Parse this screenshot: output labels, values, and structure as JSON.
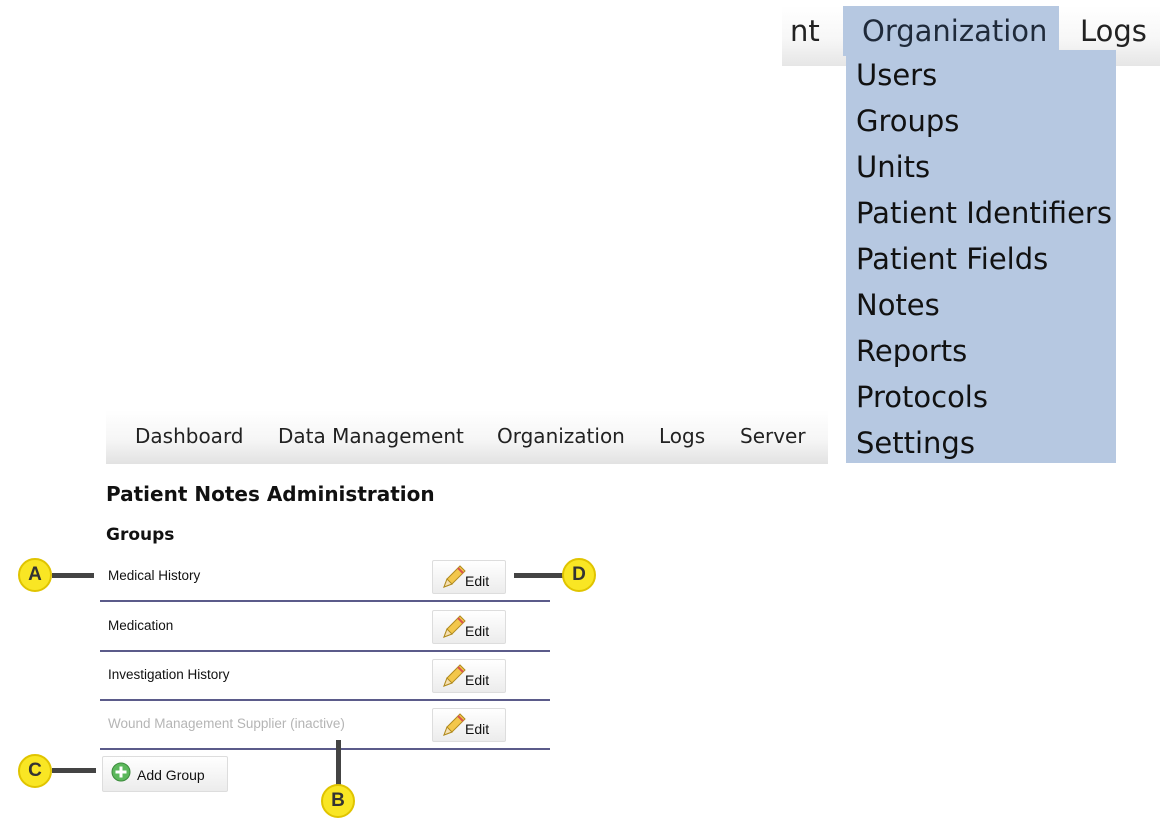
{
  "zoom_menu": {
    "partial_item": "nt",
    "active_item": "Organization",
    "logs_item": "Logs",
    "dropdown": [
      "Users",
      "Groups",
      "Units",
      "Patient Identifiers",
      "Patient Fields",
      "Notes",
      "Reports",
      "Protocols",
      "Settings"
    ],
    "highlight_color": "#b6c8e1"
  },
  "nav": {
    "items": [
      "Dashboard",
      "Data Management",
      "Organization",
      "Logs",
      "Server"
    ]
  },
  "page": {
    "title": "Patient Notes Administration",
    "section": "Groups"
  },
  "groups": [
    {
      "name": "Medical History",
      "edit": "Edit",
      "inactive": false
    },
    {
      "name": "Medication",
      "edit": "Edit",
      "inactive": false
    },
    {
      "name": "Investigation History",
      "edit": "Edit",
      "inactive": false
    },
    {
      "name": "Wound Management Supplier (inactive)",
      "edit": "Edit",
      "inactive": true
    }
  ],
  "add_group_label": "Add Group",
  "callouts": {
    "a": "A",
    "b": "B",
    "c": "C",
    "d": "D"
  },
  "icons": {
    "edit": "pencil-icon",
    "add": "plus-circle-icon"
  },
  "colors": {
    "row_divider": "#5b5b8a",
    "callout": "#f9e624",
    "inactive_text": "#b5b5b5"
  }
}
